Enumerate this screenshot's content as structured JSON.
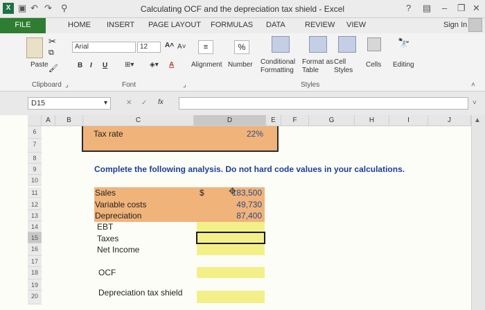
{
  "app": {
    "title": "Calculating OCF and the depreciation tax shield - Excel",
    "sign_in": "Sign In",
    "help": "?"
  },
  "tabs": [
    "FILE",
    "HOME",
    "INSERT",
    "PAGE LAYOUT",
    "FORMULAS",
    "DATA",
    "REVIEW",
    "VIEW"
  ],
  "ribbon": {
    "paste": "Paste",
    "font_name": "Arial",
    "font_size": "12",
    "bold": "B",
    "italic": "I",
    "underline": "U",
    "alignment": "Alignment",
    "number": "Number",
    "percent": "%",
    "conditional_formatting": "Conditional\nFormatting",
    "format_as_table": "Format as\nTable",
    "cell_styles": "Cell\nStyles",
    "cells": "Cells",
    "editing": "Editing",
    "groups": [
      "Clipboard",
      "Font",
      "Styles"
    ]
  },
  "formula_bar": {
    "name_box": "D15",
    "fx": "fx",
    "formula": ""
  },
  "columns": [
    "A",
    "B",
    "C",
    "D",
    "E",
    "F",
    "G",
    "H",
    "I",
    "J"
  ],
  "rows": [
    "6",
    "7",
    "8",
    "9",
    "10",
    "11",
    "12",
    "13",
    "14",
    "15",
    "16",
    "17",
    "18",
    "19",
    "20"
  ],
  "sheet": {
    "tax_rate_label": "Tax rate",
    "tax_rate_value": "22%",
    "instruction": "Complete the following analysis. Do not hard code values in your calculations.",
    "labels": [
      "Sales",
      "Variable costs",
      "Depreciation",
      "EBT",
      "Taxes",
      "Net Income",
      "OCF",
      "Depreciation tax shield"
    ],
    "currency": "$",
    "sales": "183,500",
    "variable_costs": "49,730",
    "depreciation": "87,400"
  },
  "colors": {
    "orange": "#f0b37a",
    "yellow": "#f3f08a",
    "instruction_blue": "#1f3d99",
    "file_tab": "#2e7d32"
  }
}
